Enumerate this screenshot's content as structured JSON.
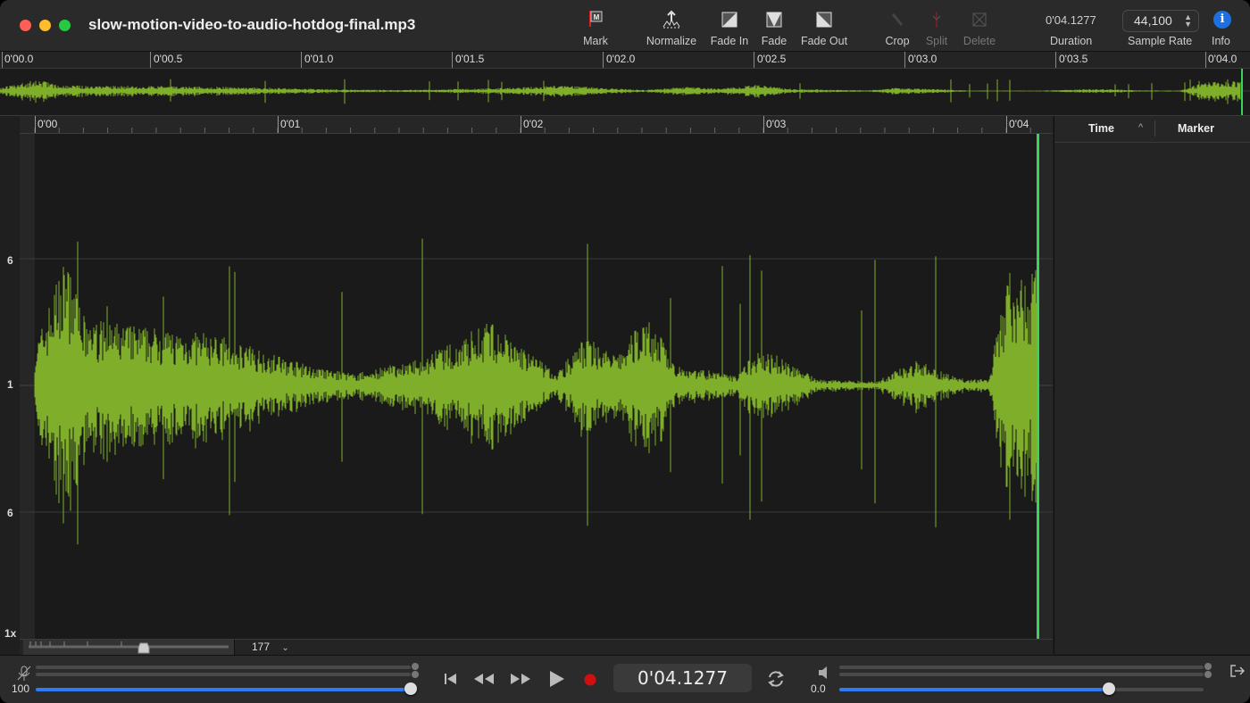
{
  "window": {
    "title": "slow-motion-video-to-audio-hotdog-final.mp3"
  },
  "toolbar": {
    "mark": "Mark",
    "normalize": "Normalize",
    "fade_in": "Fade In",
    "fade": "Fade",
    "fade_out": "Fade Out",
    "crop": "Crop",
    "split": "Split",
    "delete": "Delete",
    "duration_value": "0'04.1277",
    "duration_label": "Duration",
    "sample_rate_value": "44,100",
    "sample_rate_label": "Sample Rate",
    "info_label": "Info"
  },
  "overview_ruler": [
    "0'00.0",
    "0'00.5",
    "0'01.0",
    "0'01.5",
    "0'02.0",
    "0'02.5",
    "0'03.0",
    "0'03.5",
    "0'04.0"
  ],
  "main_ruler": [
    "0'00",
    "0'01",
    "0'02",
    "0'03",
    "0'04"
  ],
  "y_axis": {
    "top": "6",
    "mid": "1",
    "bottom": "6",
    "zoom": "1x"
  },
  "zoom": {
    "value": "177"
  },
  "marker_panel": {
    "col_time": "Time",
    "col_marker": "Marker"
  },
  "transport": {
    "input_level": "100",
    "output_level": "0.0",
    "time": "0'04.1277",
    "input_slider_fraction": 1.0,
    "output_slider_fraction": 0.74
  },
  "colors": {
    "waveform": "#7fae2a",
    "playhead": "#3ad45c",
    "accent": "#2f7bf5",
    "record": "#d10f0f"
  },
  "icons": [
    "mark-flag-icon",
    "normalize-icon",
    "fade-in-icon",
    "fade-icon",
    "fade-out-icon",
    "crop-icon",
    "split-icon",
    "delete-icon",
    "info-icon",
    "microphone-icon",
    "skip-back-icon",
    "rewind-icon",
    "fast-forward-icon",
    "play-icon",
    "record-icon",
    "loop-icon",
    "speaker-icon",
    "export-icon"
  ]
}
